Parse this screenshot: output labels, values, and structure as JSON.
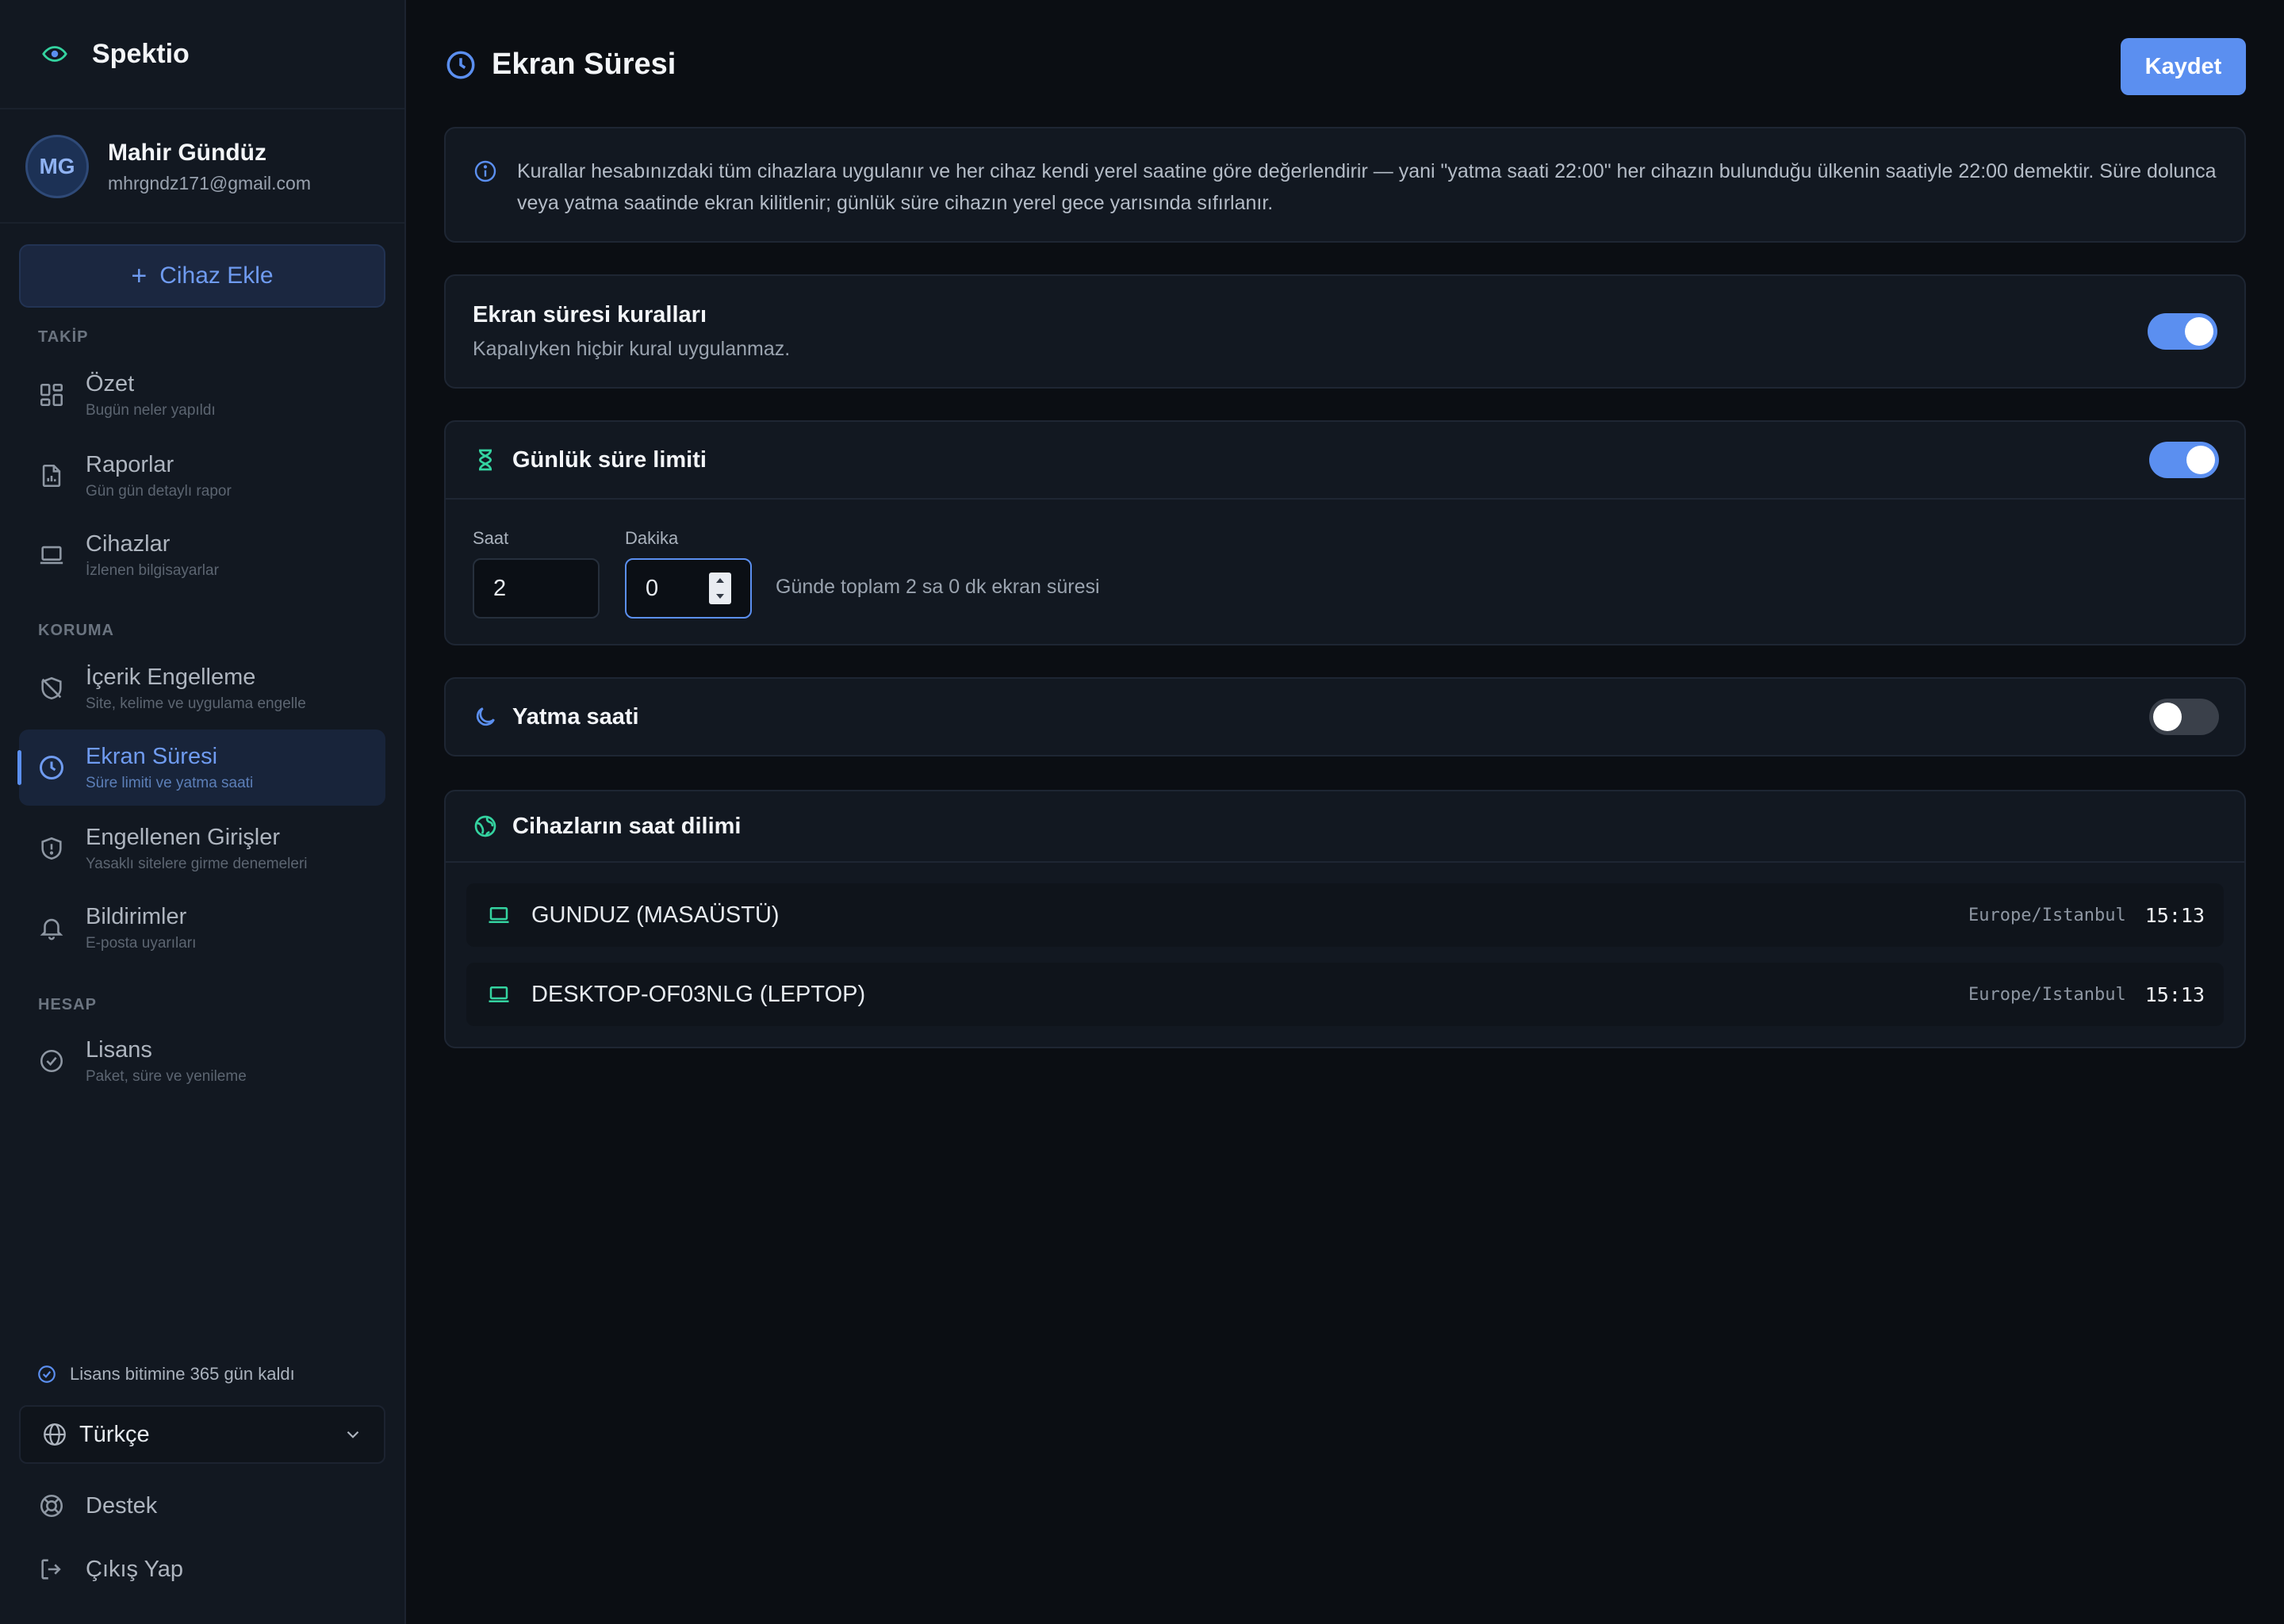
{
  "app": {
    "name": "Spektio"
  },
  "profile": {
    "initials": "MG",
    "name": "Mahir Gündüz",
    "email": "mhrgndz171@gmail.com"
  },
  "sidebar": {
    "add_device": "Cihaz Ekle",
    "sections": {
      "tracking": "TAKİP",
      "protection": "KORUMA",
      "account": "HESAP"
    },
    "items": [
      {
        "title": "Özet",
        "subtitle": "Bugün neler yapıldı",
        "icon": "grid-icon"
      },
      {
        "title": "Raporlar",
        "subtitle": "Gün gün detaylı rapor",
        "icon": "report-icon"
      },
      {
        "title": "Cihazlar",
        "subtitle": "İzlenen bilgisayarlar",
        "icon": "laptop-icon"
      },
      {
        "title": "İçerik Engelleme",
        "subtitle": "Site, kelime ve uygulama engelle",
        "icon": "shield-off-icon"
      },
      {
        "title": "Ekran Süresi",
        "subtitle": "Süre limiti ve yatma saati",
        "icon": "clock-icon",
        "active": true
      },
      {
        "title": "Engellenen Girişler",
        "subtitle": "Yasaklı sitelere girme denemeleri",
        "icon": "shield-alert-icon"
      },
      {
        "title": "Bildirimler",
        "subtitle": "E-posta uyarıları",
        "icon": "bell-icon"
      },
      {
        "title": "Lisans",
        "subtitle": "Paket, süre ve yenileme",
        "icon": "check-circle-icon"
      }
    ],
    "license_notice": "Lisans bitimine 365 gün kaldı",
    "language": "Türkçe",
    "support": "Destek",
    "logout": "Çıkış Yap"
  },
  "page": {
    "title": "Ekran Süresi",
    "save": "Kaydet",
    "info": "Kurallar hesabınızdaki tüm cihazlara uygulanır ve her cihaz kendi yerel saatine göre değerlendirir — yani \"yatma saati 22:00\" her cihazın bulunduğu ülkenin saatiyle 22:00 demektir. Süre dolunca veya yatma saatinde ekran kilitlenir; günlük süre cihazın yerel gece yarısında sıfırlanır.",
    "rules": {
      "title": "Ekran süresi kuralları",
      "subtitle": "Kapalıyken hiçbir kural uygulanmaz.",
      "enabled": true
    },
    "daily_limit": {
      "title": "Günlük süre limiti",
      "enabled": true,
      "hours_label": "Saat",
      "hours_value": "2",
      "minutes_label": "Dakika",
      "minutes_value": "0",
      "note": "Günde toplam 2 sa 0 dk ekran süresi"
    },
    "bedtime": {
      "title": "Yatma saati",
      "enabled": false
    },
    "timezones": {
      "title": "Cihazların saat dilimi",
      "devices": [
        {
          "name": "GUNDUZ (MASAÜSTÜ)",
          "zone": "Europe/Istanbul",
          "time": "15:13"
        },
        {
          "name": "DESKTOP-OF03NLG (LEPTOP)",
          "zone": "Europe/Istanbul",
          "time": "15:13"
        }
      ]
    }
  },
  "colors": {
    "accent": "#5b8ff0",
    "teal": "#34d3a0",
    "background": "#0b0e13",
    "sidebar": "#121821"
  }
}
